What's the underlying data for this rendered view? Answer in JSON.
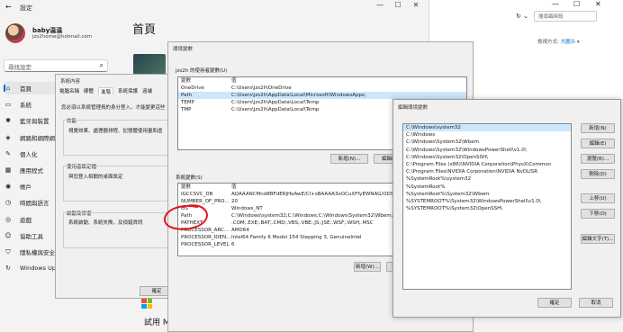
{
  "settings": {
    "window_title": "設定",
    "user": {
      "name": "baby温温",
      "email": "jzs2home@hotmail.com"
    },
    "search_placeholder": "尋找設定",
    "page_title": "首頁",
    "nav": [
      {
        "label": "首頁",
        "icon": "home-icon",
        "glyph": "⌂",
        "active": true
      },
      {
        "label": "系統",
        "icon": "monitor-icon",
        "glyph": "▭"
      },
      {
        "label": "藍牙與裝置",
        "icon": "bluetooth-icon",
        "glyph": "✱"
      },
      {
        "label": "網路和網際網",
        "icon": "wifi-icon",
        "glyph": "◈"
      },
      {
        "label": "個人化",
        "icon": "brush-icon",
        "glyph": "✎"
      },
      {
        "label": "應用程式",
        "icon": "apps-icon",
        "glyph": "▦"
      },
      {
        "label": "帳戶",
        "icon": "person-icon",
        "glyph": "◉"
      },
      {
        "label": "時間與語言",
        "icon": "clock-icon",
        "glyph": "◷"
      },
      {
        "label": "遊戲",
        "icon": "gamepad-icon",
        "glyph": "◎"
      },
      {
        "label": "協助工具",
        "icon": "accessibility-icon",
        "glyph": "☺"
      },
      {
        "label": "隱私權與安全",
        "icon": "shield-icon",
        "glyph": "⛉"
      },
      {
        "label": "Windows Up",
        "icon": "update-icon",
        "glyph": "↻"
      }
    ],
    "bottom_text": "試用 M"
  },
  "explorer": {
    "search_placeholder": "搜尋臨時設",
    "view_option_label": "檢視方式:",
    "view_option_value": "大圖示 ▾"
  },
  "system_properties": {
    "title": "系統內容",
    "tabs": [
      "電腦名稱",
      "硬體",
      "進階",
      "系統保護",
      "遠端"
    ],
    "selected_tab": "進階",
    "note": "您必須以系統管理員的身分登入，才能變更這些",
    "performance_label": "效能",
    "performance_text": "視覺效果、處理器排程、記憶體使用量和虛",
    "profile_label": "使用者設定檔",
    "profile_text": "與您登入相關的桌面設定",
    "startup_label": "啟動及修復",
    "startup_text": "系統啟動、系統失敗，及偵錯資訊",
    "ok": "確定"
  },
  "env_vars": {
    "title": "環境變數",
    "user_section_label": "jzs2h 的使用者變數(U)",
    "col_variable": "變數",
    "col_value": "值",
    "user_vars": [
      {
        "name": "OneDrive",
        "value": "C:\\Users\\jzs2h\\OneDrive"
      },
      {
        "name": "Path",
        "value": "C:\\Users\\jzs2h\\AppData\\Local\\Microsoft\\WindowsApps;",
        "selected": true
      },
      {
        "name": "TEMP",
        "value": "C:\\Users\\jzs2h\\AppData\\Local\\Temp"
      },
      {
        "name": "TMP",
        "value": "C:\\Users\\jzs2h\\AppData\\Local\\Temp"
      }
    ],
    "user_buttons": [
      "新增(N)...",
      "編輯(E)..."
    ],
    "system_section_label": "系統變數(S)",
    "system_vars": [
      {
        "name": "IGCCSVC_DB",
        "value": "AQAAANCMnd8BFdERjHoAwE/Cl+sBAAAA3xOCuXFfyEWNAG/ODSQ"
      },
      {
        "name": "NUMBER_OF_PRO...",
        "value": "20"
      },
      {
        "name": "OS",
        "value": "Windows_NT"
      },
      {
        "name": "Path",
        "value": "C:\\Windows\\system32;C:\\Windows;C:\\Windows\\System32\\Wbem;C:\\"
      },
      {
        "name": "PATHEXT",
        "value": ".COM;.EXE;.BAT;.CMD;.VBS;.VBE;.JS;.JSE;.WSF;.WSH;.MSC"
      },
      {
        "name": "PROCESSOR_ARC...",
        "value": "AMD64"
      },
      {
        "name": "PROCESSOR_IDEN...",
        "value": "Intel64 Family 6 Model 154 Stepping 3, GenuineIntel"
      },
      {
        "name": "PROCESSOR_LEVEL",
        "value": "6"
      }
    ],
    "system_buttons": [
      "新增(W)...",
      "編"
    ]
  },
  "edit_env": {
    "title": "編輯環境變數",
    "paths": [
      {
        "text": "C:\\Windows\\system32",
        "selected": true
      },
      {
        "text": "C:\\Windows"
      },
      {
        "text": "C:\\Windows\\System32\\Wbem"
      },
      {
        "text": "C:\\Windows\\System32\\WindowsPowerShell\\v1.0\\"
      },
      {
        "text": "C:\\Windows\\System32\\OpenSSH\\"
      },
      {
        "text": "C:\\Program Files (x86)\\NVIDIA Corporation\\PhysX\\Common"
      },
      {
        "text": "C:\\Program Files\\NVIDIA Corporation\\NVIDIA NvDLISR"
      },
      {
        "text": "%SystemRoot%\\system32"
      },
      {
        "text": "%SystemRoot%"
      },
      {
        "text": "%SystemRoot%\\System32\\Wbem"
      },
      {
        "text": "%SYSTEMROOT%\\System32\\WindowsPowerShell\\v1.0\\"
      },
      {
        "text": "%SYSTEMROOT%\\System32\\OpenSSH\\"
      }
    ],
    "buttons": [
      "新增(N)",
      "編輯(E)",
      "瀏覽(B)...",
      "刪除(D)",
      "上移(U)",
      "下移(O)",
      "編輯文字(T)..."
    ],
    "ok": "確定",
    "cancel": "取消"
  },
  "colors": {
    "accent": "#0067c0",
    "selection": "#cce8ff",
    "annotation": "#e0161b"
  }
}
